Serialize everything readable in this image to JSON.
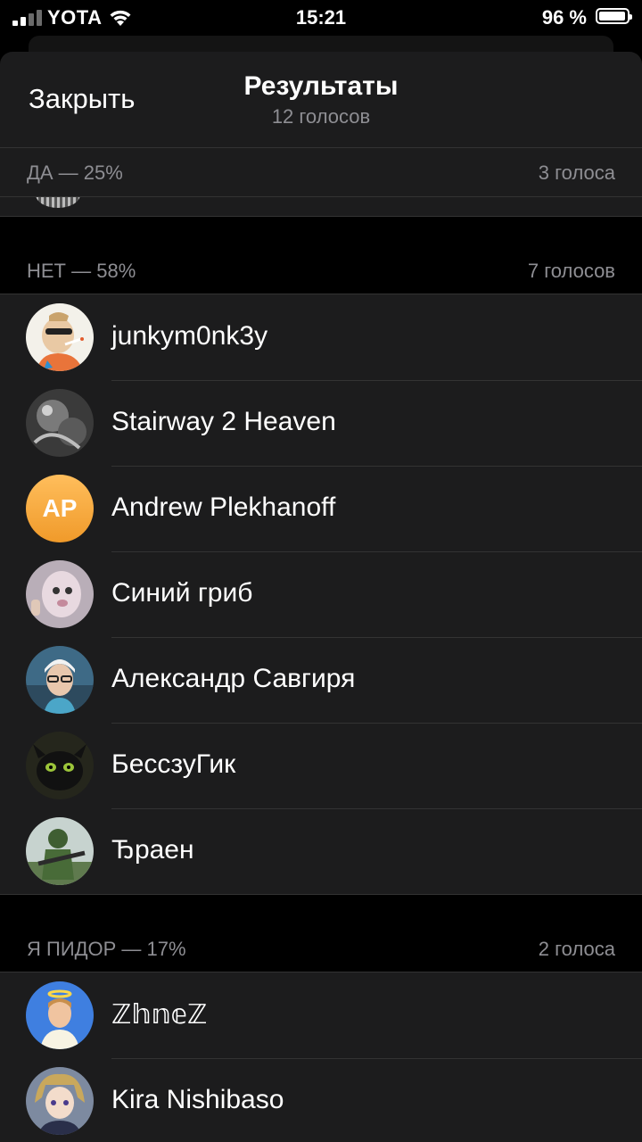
{
  "status_bar": {
    "carrier": "YOTA",
    "time": "15:21",
    "battery": "96 %"
  },
  "header": {
    "close_label": "Закрыть",
    "title": "Результаты",
    "subtitle": "12 голосов"
  },
  "sections": [
    {
      "option": "ДА — 25%",
      "count": "3 голоса"
    },
    {
      "option": "НЕТ — 58%",
      "count": "7 голосов"
    },
    {
      "option": "Я ПИДОР — 17%",
      "count": "2 голоса"
    }
  ],
  "voters_no": [
    {
      "name": "junkym0nk3y",
      "avatar_icon": "cartoon-smoker-icon"
    },
    {
      "name": "Stairway 2 Heaven",
      "avatar_icon": "photo-avatar-icon"
    },
    {
      "name": "Andrew Plekhanoff",
      "initials": "AP",
      "avatar_color": "#f6a93b"
    },
    {
      "name": "Синий гриб",
      "avatar_icon": "cartoon-avatar-icon"
    },
    {
      "name": "Александр Савгиря",
      "avatar_icon": "photo-avatar-icon"
    },
    {
      "name": "БессзуГик",
      "avatar_icon": "dragon-avatar-icon"
    },
    {
      "name": "Ђраен",
      "avatar_icon": "soldier-avatar-icon"
    }
  ],
  "voters_me": [
    {
      "name": "ℤ𝕙𝕟𝕖ℤ",
      "avatar_icon": "photo-avatar-icon"
    },
    {
      "name": "Kira Nishibaso",
      "avatar_icon": "anime-avatar-icon"
    }
  ]
}
